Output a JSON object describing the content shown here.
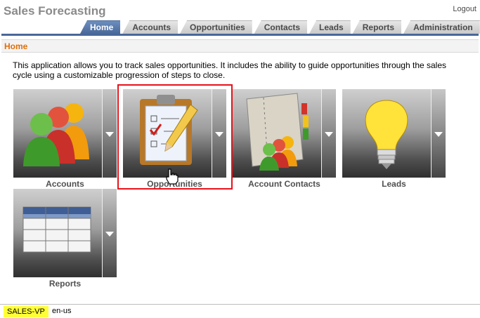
{
  "app": {
    "title": "Sales Forecasting",
    "logout_label": "Logout"
  },
  "tabs": [
    {
      "label": "Home",
      "active": true
    },
    {
      "label": "Accounts"
    },
    {
      "label": "Opportunities"
    },
    {
      "label": "Contacts"
    },
    {
      "label": "Leads"
    },
    {
      "label": "Reports"
    },
    {
      "label": "Administration"
    }
  ],
  "breadcrumb": {
    "current": "Home"
  },
  "intro": "This application allows you to track sales opportunities. It includes the ability to guide opportunities through the sales cycle using a customizable progression of steps to close.",
  "tiles": [
    {
      "label": "Accounts",
      "icon": "people-group-icon"
    },
    {
      "label": "Opportunities",
      "icon": "clipboard-checklist-icon",
      "highlighted": true
    },
    {
      "label": "Account Contacts",
      "icon": "address-book-icon"
    },
    {
      "label": "Leads",
      "icon": "light-bulb-icon"
    },
    {
      "label": "Reports",
      "icon": "table-icon"
    }
  ],
  "footer": {
    "user": "SALES-VP",
    "locale": "en-us"
  },
  "colors": {
    "tab_active": "#49689a",
    "breadcrumb": "#e06f0a",
    "highlight": "#e8121a",
    "user_badge": "#ffff38"
  }
}
